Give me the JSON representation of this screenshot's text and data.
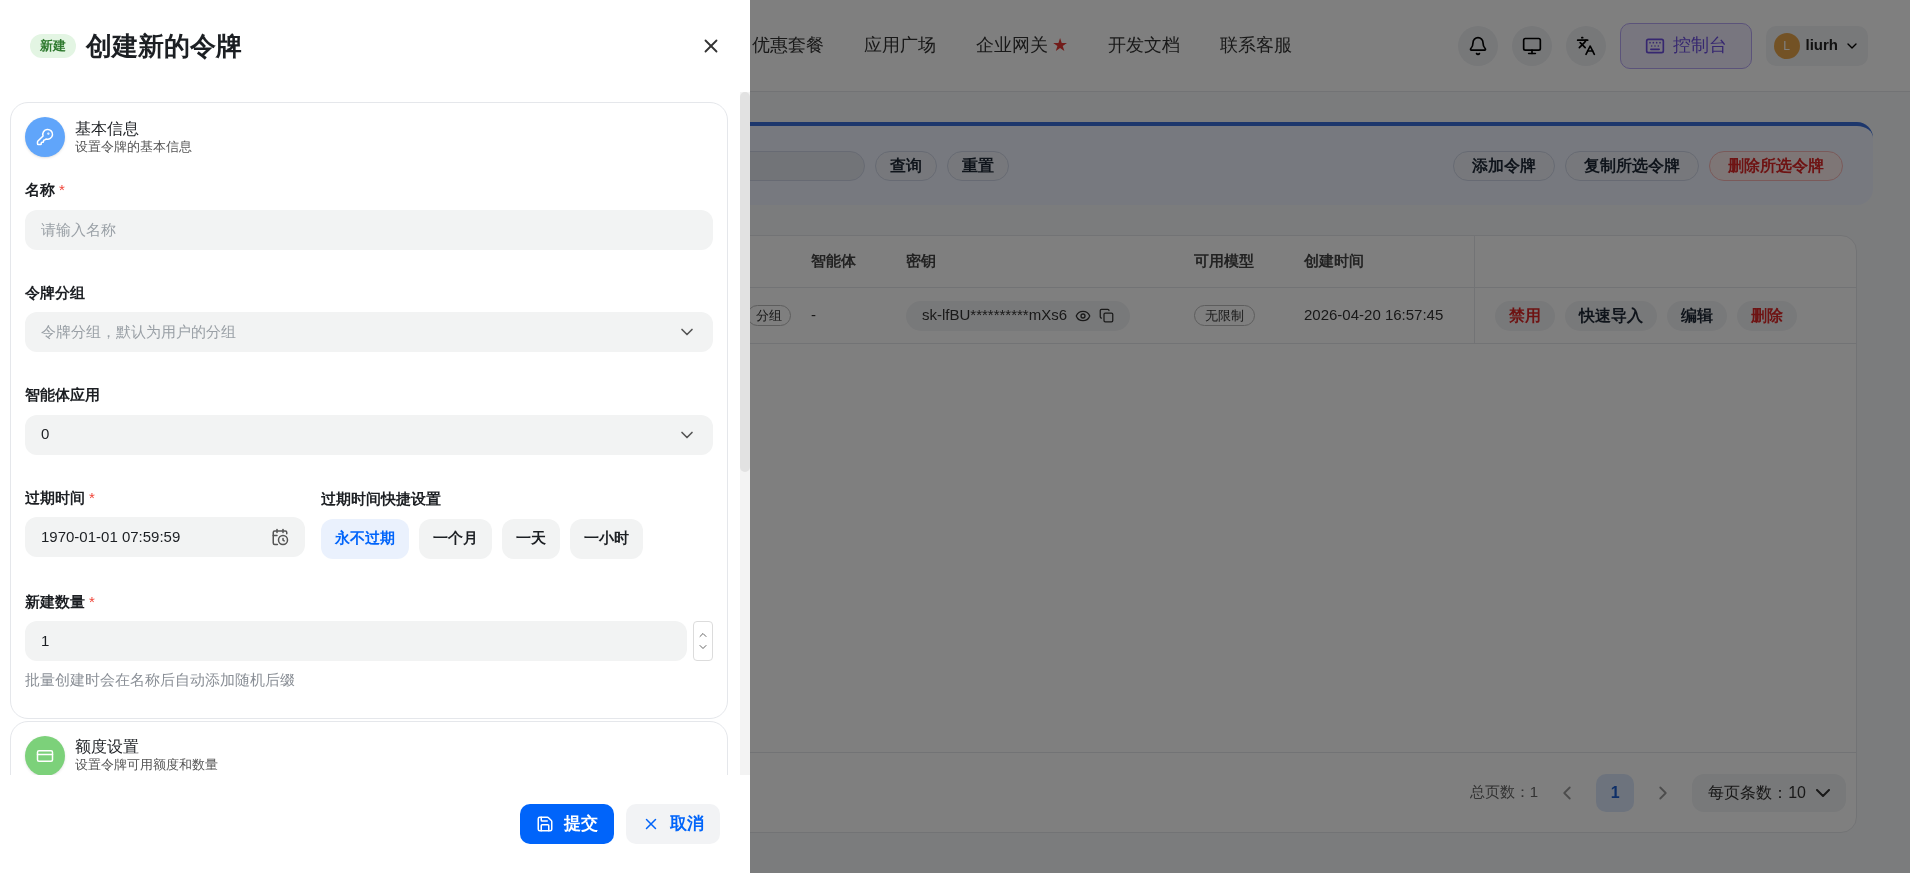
{
  "nav": {
    "items": [
      {
        "label": "优惠套餐"
      },
      {
        "label": "应用广场"
      },
      {
        "label": "企业网关",
        "star": "★"
      },
      {
        "label": "开发文档"
      },
      {
        "label": "联系客服"
      }
    ],
    "console_button": "控制台",
    "user": {
      "initial": "L",
      "name": "liurh"
    }
  },
  "toolbar": {
    "buttons": [
      {
        "label": "查询",
        "kind": "normal"
      },
      {
        "label": "重置",
        "kind": "normal"
      }
    ],
    "actions": [
      {
        "label": "添加令牌",
        "kind": "normal"
      },
      {
        "label": "复制所选令牌",
        "kind": "normal"
      },
      {
        "label": "删除所选令牌",
        "kind": "danger"
      }
    ]
  },
  "table": {
    "columns": [
      "智能体",
      "密钥",
      "可用模型",
      "创建时间"
    ],
    "rows": [
      {
        "group": "分组",
        "agent": "-",
        "key": "sk-lfBU**********mXs6",
        "models": "无限制",
        "created": "2026-04-20 16:57:45",
        "actions": [
          {
            "label": "禁用",
            "kind": "danger"
          },
          {
            "label": "快速导入",
            "kind": "normal"
          },
          {
            "label": "编辑",
            "kind": "normal"
          },
          {
            "label": "删除",
            "kind": "danger"
          }
        ]
      }
    ]
  },
  "pagination": {
    "total": "总页数：1",
    "pages": [
      {
        "label": "1",
        "selected": true
      }
    ],
    "page_size": "每页条数：10"
  },
  "drawer": {
    "badge": "新建",
    "title": "创建新的令牌",
    "sections": [
      {
        "kind": "key",
        "title": "基本信息",
        "subtitle": "设置令牌的基本信息",
        "fields": [
          {
            "kind": "text",
            "label": "名称",
            "mark": "*",
            "placeholder": "请输入名称"
          },
          {
            "kind": "select",
            "label": "令牌分组",
            "placeholder": "令牌分组，默认为用户的分组"
          },
          {
            "kind": "select",
            "label": "智能体应用",
            "value": "0"
          },
          {
            "kind": "datetime",
            "label": "过期时间",
            "mark": "*",
            "value": "1970-01-01 07:59:59",
            "quick_label": "过期时间快捷设置",
            "options": [
              {
                "label": "永不过期",
                "selected": true
              },
              {
                "label": "一个月",
                "selected": false
              },
              {
                "label": "一天",
                "selected": false
              },
              {
                "label": "一小时",
                "selected": false
              }
            ]
          },
          {
            "kind": "number",
            "label": "新建数量",
            "mark": "*",
            "value": "1",
            "help": "批量创建时会在名称后自动添加随机后缀"
          }
        ]
      },
      {
        "kind": "card",
        "title": "额度设置",
        "subtitle": "设置令牌可用额度和数量"
      }
    ],
    "submit": "提交",
    "cancel": "取消"
  }
}
